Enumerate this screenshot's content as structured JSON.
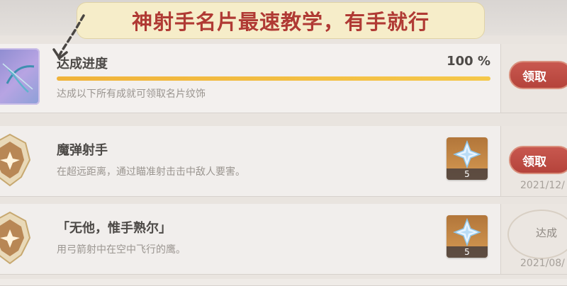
{
  "banner": {
    "title": "神射手名片最速教学，有手就行"
  },
  "progress_row": {
    "label": "达成进度",
    "percent_text": "100 %",
    "progress_value": 1.0,
    "description": "达成以下所有成就可领取名片纹饰",
    "claim_label": "领取"
  },
  "achievements": [
    {
      "title": "魔弹射手",
      "description": "在超远距离，通过瞄准射击击中敌人要害。",
      "reward_count": "5",
      "claim_label": "领取",
      "date": "2021/12/"
    },
    {
      "title": "「无他，惟手熟尔」",
      "description": "用弓箭射中在空中飞行的鹰。",
      "reward_count": "5",
      "status": "达成",
      "date": "2021/08/"
    }
  ],
  "colors": {
    "banner_text": "#b03a34",
    "claim_button": "#b5433b",
    "progress_fill": "#f0b33a"
  },
  "icons": [
    "arrow-annotation-icon",
    "namecard-icon",
    "achievement-badge-icon",
    "primogem-icon"
  ]
}
